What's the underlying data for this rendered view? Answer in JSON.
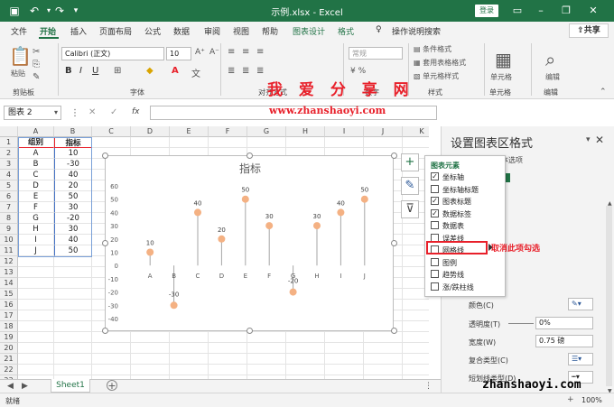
{
  "title_bar": {
    "title": "示例.xlsx  -  Excel",
    "login": "登录",
    "icons": [
      "save-icon",
      "undo-icon",
      "redo-icon",
      "customize-icon",
      "ribbon-display-icon",
      "minimize-icon",
      "restore-icon",
      "close-icon"
    ]
  },
  "menu": {
    "tabs": [
      "文件",
      "开始",
      "插入",
      "页面布局",
      "公式",
      "数据",
      "审阅",
      "视图",
      "帮助",
      "图表设计",
      "格式"
    ],
    "active": "开始",
    "tell_me": "操作说明搜索",
    "share": "共享"
  },
  "ribbon": {
    "paste": "粘贴",
    "font_name": "Calibri (正文)",
    "font_size": "10",
    "number_format": "常规",
    "cond_format": "条件格式",
    "table_format": "套用表格格式",
    "cell_style": "单元格样式",
    "groups": {
      "clipboard": "剪贴板",
      "font": "字体",
      "align": "对齐方式",
      "number": "数字",
      "styles": "样式",
      "cells": "单元格",
      "editing": "编辑"
    },
    "cells_btn": "单元格",
    "edit_btn": "编辑"
  },
  "watermark": {
    "line1": "我 爱 分 享 网",
    "line2": "www.zhanshaoyi.com",
    "line3": "zhanshaoyi.com"
  },
  "formula_bar": {
    "name_box": "图表 2",
    "fx": "fx",
    "value": ""
  },
  "grid": {
    "columns": [
      "A",
      "B",
      "C",
      "D",
      "E",
      "F",
      "G",
      "H",
      "I",
      "J",
      "K"
    ],
    "rows": [
      "1",
      "2",
      "3",
      "4",
      "5",
      "6",
      "7",
      "8",
      "9",
      "10",
      "11",
      "12",
      "13",
      "14",
      "15",
      "16",
      "17",
      "18",
      "19",
      "20",
      "21",
      "22",
      "23"
    ],
    "header_a": "组别",
    "header_b": "指标",
    "data": [
      [
        "A",
        "10"
      ],
      [
        "B",
        "-30"
      ],
      [
        "C",
        "40"
      ],
      [
        "D",
        "20"
      ],
      [
        "E",
        "50"
      ],
      [
        "F",
        "30"
      ],
      [
        "G",
        "-20"
      ],
      [
        "H",
        "30"
      ],
      [
        "I",
        "40"
      ],
      [
        "J",
        "50"
      ]
    ]
  },
  "chart_data": {
    "type": "scatter",
    "title": "指标",
    "categories": [
      "A",
      "B",
      "C",
      "D",
      "E",
      "F",
      "G",
      "H",
      "I",
      "J"
    ],
    "values": [
      10,
      -30,
      40,
      20,
      50,
      30,
      -20,
      30,
      40,
      50
    ],
    "data_labels": [
      "10",
      "-30",
      "40",
      "20",
      "50",
      "30",
      "-20",
      "30",
      "40",
      "50"
    ],
    "ylim": [
      -40,
      60
    ],
    "yticks": [
      "60",
      "50",
      "40",
      "30",
      "20",
      "10",
      "0",
      "-10",
      "-20",
      "-30",
      "-40"
    ],
    "grid": false,
    "marker_color": "#F4B183",
    "line_color": "#A6A6A6"
  },
  "chart_elements": {
    "title": "图表元素",
    "items": [
      {
        "label": "坐标轴",
        "checked": true
      },
      {
        "label": "坐标轴标题",
        "checked": false
      },
      {
        "label": "图表标题",
        "checked": true
      },
      {
        "label": "数据标签",
        "checked": true
      },
      {
        "label": "数据表",
        "checked": false
      },
      {
        "label": "误差线",
        "checked": false
      },
      {
        "label": "网格线",
        "checked": false
      },
      {
        "label": "图例",
        "checked": false
      },
      {
        "label": "趋势线",
        "checked": false
      },
      {
        "label": "涨/跌柱线",
        "checked": false
      }
    ],
    "annotation": "取消此项勾选"
  },
  "format_pane": {
    "title": "设置图表区格式",
    "subtitle": "本选项",
    "color_label": "颜色(C)",
    "transparency_label": "透明度(T)",
    "transparency_value": "0%",
    "width_label": "宽度(W)",
    "width_value": "0.75 磅",
    "compound_label": "复合类型(C)",
    "dash_label": "短划线类型(D)"
  },
  "sheet": {
    "tab": "Sheet1",
    "add": "+"
  },
  "status": {
    "ready": "就绪",
    "zoom": "100%"
  }
}
